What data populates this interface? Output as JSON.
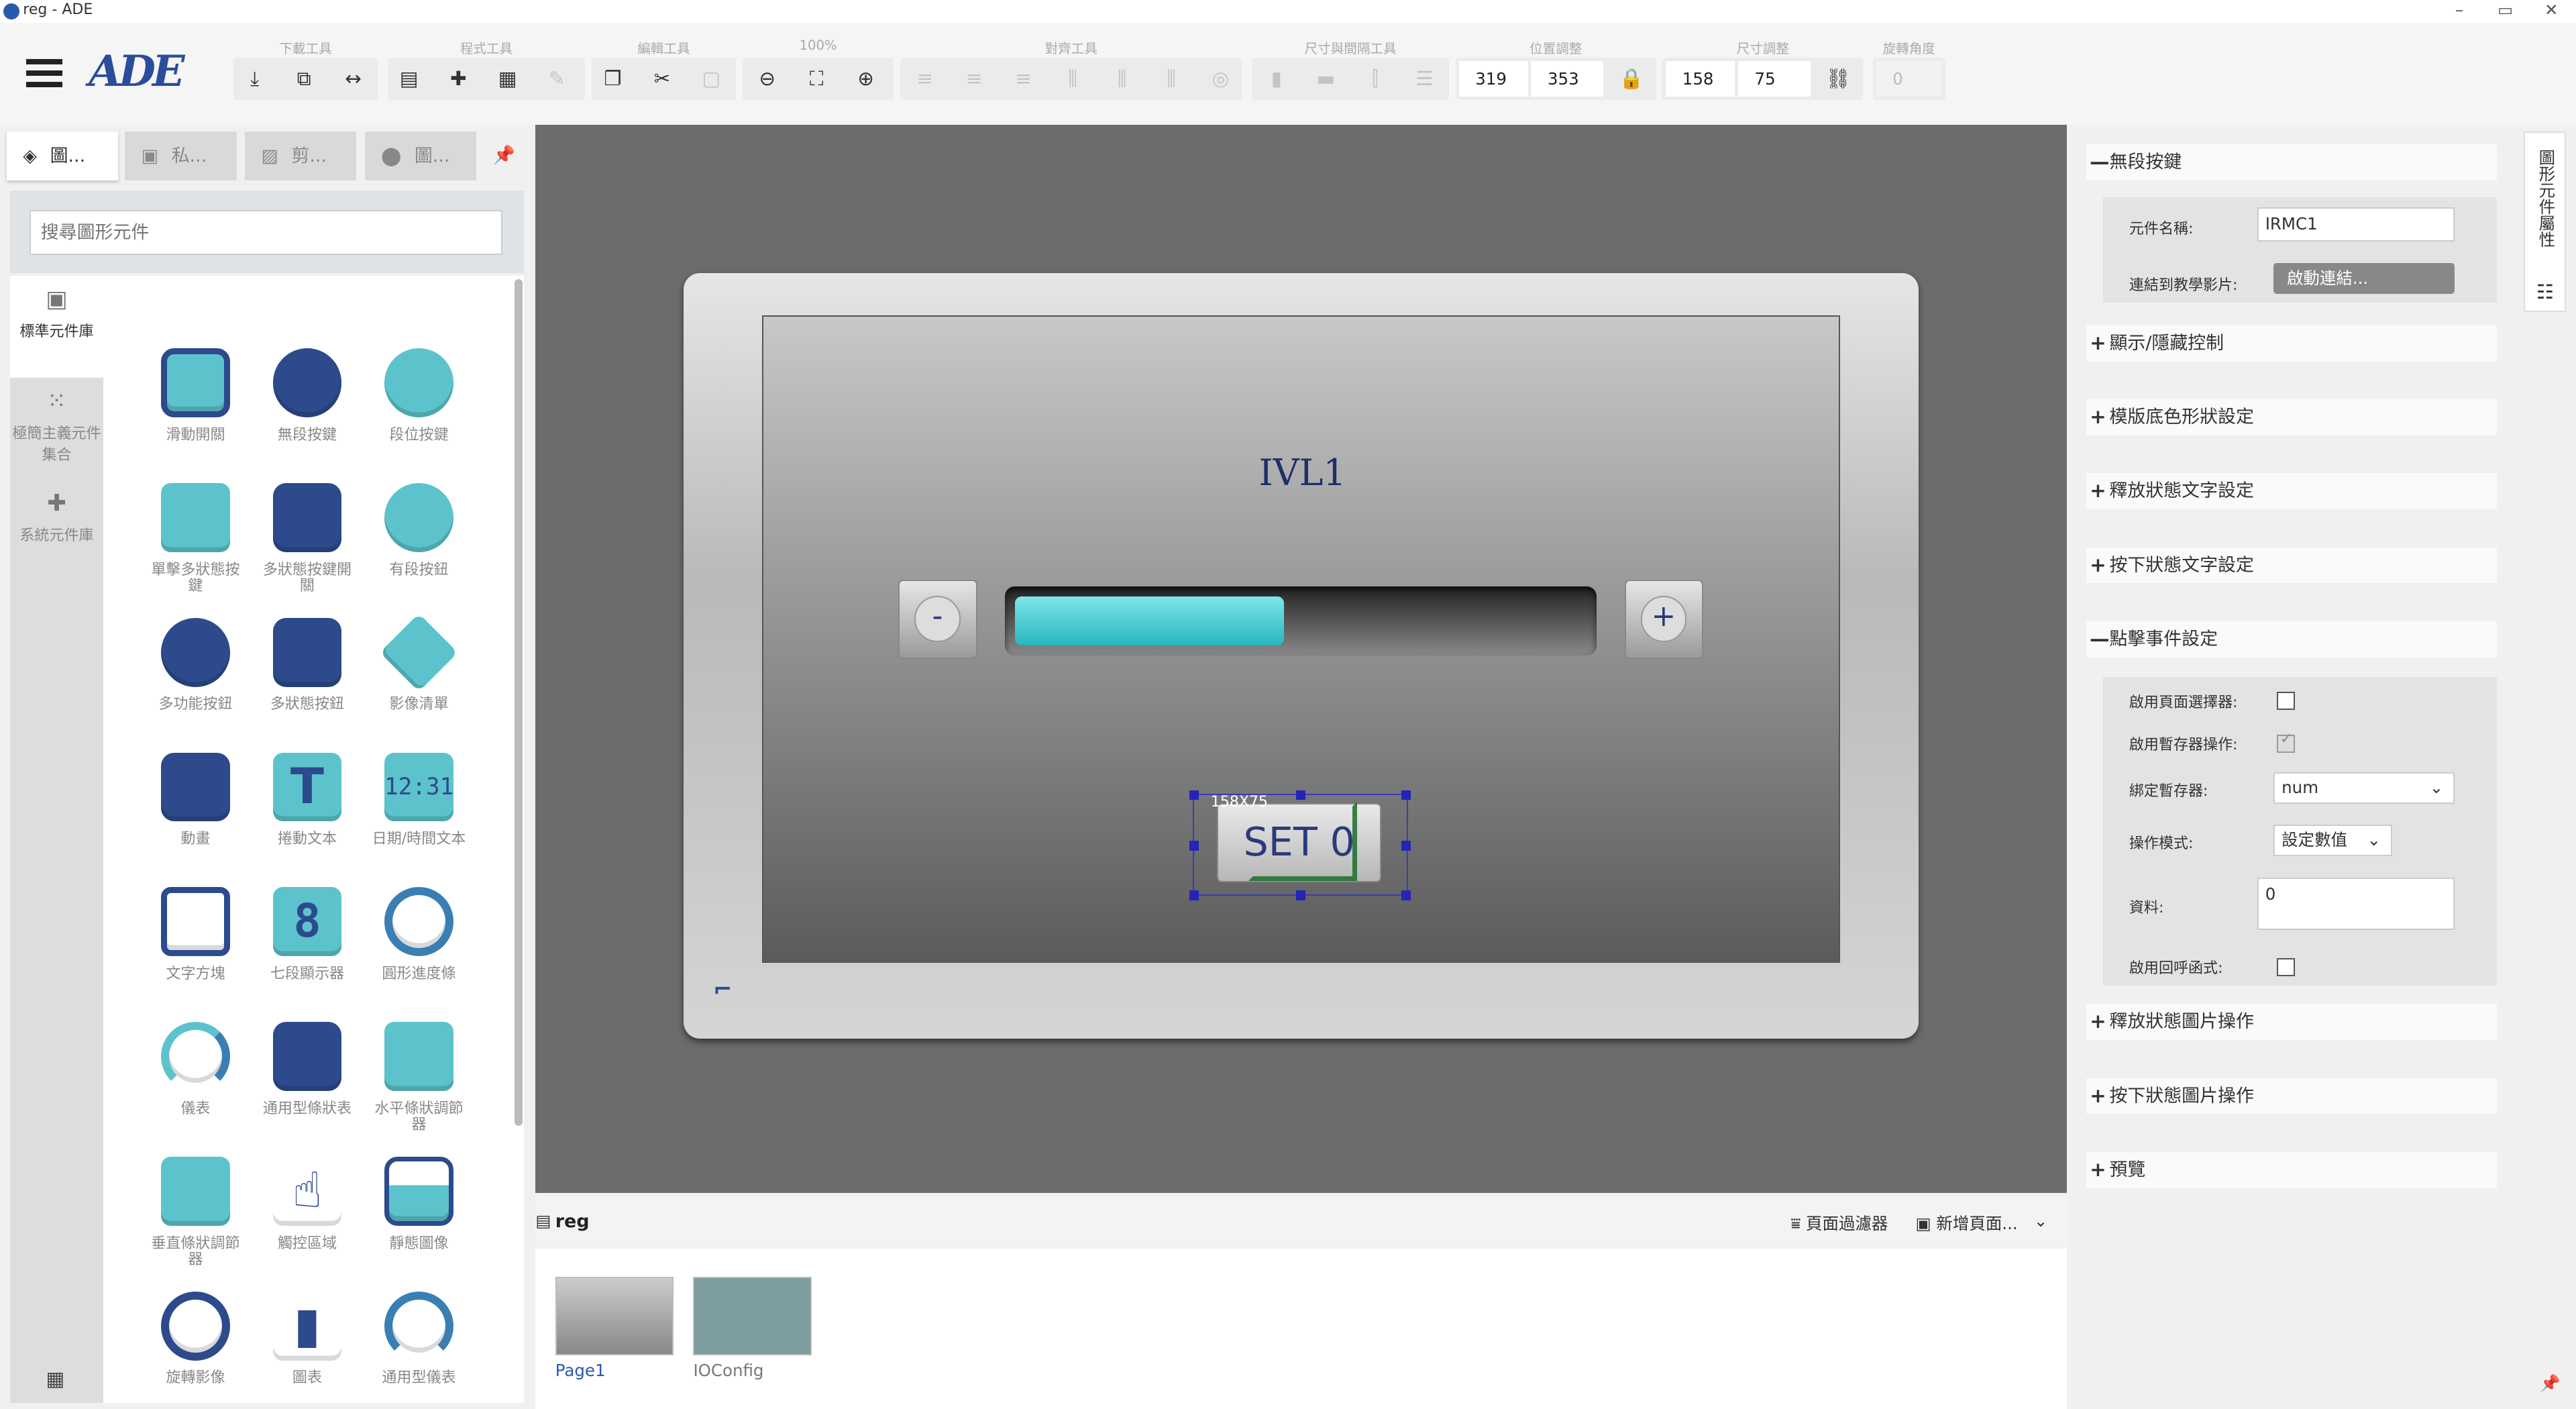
{
  "window": {
    "title": "reg - ADE",
    "min": "–",
    "max": "▭",
    "close": "✕"
  },
  "toolbar": {
    "groups": [
      "下載工具",
      "程式工具",
      "編輯工具",
      "100%",
      "對齊工具",
      "尺寸與間隔工具",
      "位置調整",
      "尺寸調整",
      "旋轉角度"
    ],
    "x": "319",
    "y": "353",
    "width": "158",
    "height": "75",
    "angle": "0"
  },
  "left": {
    "tabs": [
      "圖...",
      "私...",
      "剪...",
      "圖..."
    ],
    "search_placeholder": "搜尋圖形元件",
    "categories": [
      "標準元件庫",
      "極簡主義元件集合",
      "系統元件庫"
    ],
    "items": [
      "滑動開關",
      "無段按鍵",
      "段位按鍵",
      "單擊多狀態按鍵",
      "多狀態按鍵開關",
      "有段按鈕",
      "多功能按鈕",
      "多狀態按鈕",
      "影像清單",
      "動畫",
      "捲動文本",
      "日期/時間文本",
      "文字方塊",
      "七段顯示器",
      "圓形進度條",
      "儀表",
      "通用型條狀表",
      "水平條狀調節器",
      "垂直條狀調節器",
      "觸控區域",
      "靜態圖像",
      "旋轉影像",
      "圖表",
      "通用型儀表"
    ]
  },
  "canvas": {
    "title": "IVL1",
    "minus": "-",
    "plus": "+",
    "set_label": "SET 0",
    "size_tag": "158X75",
    "bar_fraction": 0.47
  },
  "pages": {
    "title": "reg",
    "filter": "頁面過濾器",
    "new_page": "新增頁面...",
    "items": [
      "Page1",
      "IOConfig"
    ]
  },
  "props": {
    "sections": [
      "無段按鍵",
      "顯示/隱藏控制",
      "模版底色形狀設定",
      "釋放狀態文字設定",
      "按下狀態文字設定",
      "點擊事件設定",
      "釋放狀態圖片操作",
      "按下狀態圖片操作",
      "預覽"
    ],
    "name_label": "元件名稱:",
    "name_value": "IRMC1",
    "link_label": "連結到教學影片:",
    "link_btn": "啟動連結...",
    "page_sel_label": "啟用頁面選擇器:",
    "reg_op_label": "啟用暫存器操作:",
    "bind_reg_label": "綁定暫存器:",
    "bind_reg_value": "num",
    "mode_label": "操作模式:",
    "mode_value": "設定數值",
    "data_label": "資料:",
    "data_value": "0",
    "callback_label": "啟用回呼函式:",
    "side_tab": "圖形元件屬性"
  }
}
